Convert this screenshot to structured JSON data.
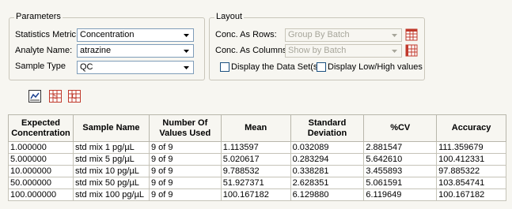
{
  "parameters": {
    "title": "Parameters",
    "statistics_metric_label": "Statistics Metric:",
    "statistics_metric_value": "Concentration",
    "analyte_name_label": "Analyte Name:",
    "analyte_name_value": "atrazine",
    "sample_type_label": "Sample Type",
    "sample_type_value": "QC"
  },
  "layout": {
    "title": "Layout",
    "conc_rows_label": "Conc. As Rows:",
    "conc_rows_value": "Group By Batch",
    "conc_columns_label": "Conc. As Columns:",
    "conc_columns_value": "Show by Batch",
    "display_data_set_label": "Display the Data Set(s)",
    "display_low_high_label": "Display Low/High values"
  },
  "table": {
    "headers": [
      "Expected Concentration",
      "Sample Name",
      "Number Of Values Used",
      "Mean",
      "Standard Deviation",
      "%CV",
      "Accuracy"
    ],
    "rows": [
      [
        "1.000000",
        "std mix 1 pg/µL",
        "9 of 9",
        "1.113597",
        "0.032089",
        "2.881547",
        "111.359679"
      ],
      [
        "5.000000",
        "std mix 5 pg/µL",
        "9 of 9",
        "5.020617",
        "0.283294",
        "5.642610",
        "100.412331"
      ],
      [
        "10.000000",
        "std mix 10 pg/µL",
        "9 of 9",
        "9.788532",
        "0.338281",
        "3.455893",
        "97.885322"
      ],
      [
        "50.000000",
        "std mix 50 pg/µL",
        "9 of 9",
        "51.927371",
        "2.628351",
        "5.061591",
        "103.854741"
      ],
      [
        "100.000000",
        "std mix 100 pg/µL",
        "9 of 9",
        "100.167182",
        "6.129880",
        "6.119649",
        "100.167182"
      ]
    ]
  },
  "icons": {
    "chart": "line-chart-icon",
    "stats_s": "s-grid-icon",
    "stats_c": "c-grid-icon",
    "rows_grid": "grid-icon",
    "columns_grid": "grid-icon"
  },
  "colors": {
    "background": "#f7f6f1",
    "border": "#c9c6ba",
    "input_border": "#7f9db9",
    "icon_red": "#c0392b"
  }
}
